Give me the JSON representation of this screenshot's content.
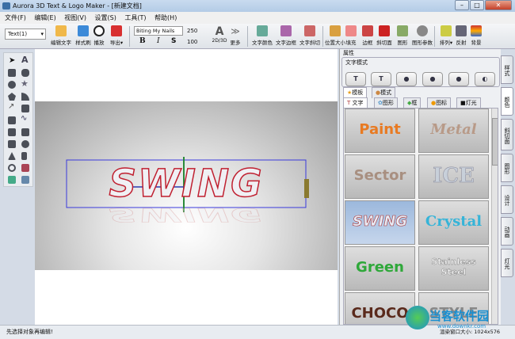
{
  "window": {
    "title": "Aurora 3D Text & Logo Maker - [新建文档]"
  },
  "menu": [
    "文件(F)",
    "编辑(E)",
    "视图(V)",
    "设置(S)",
    "工具(T)",
    "帮助(H)"
  ],
  "toolbar": {
    "object_select": "Text(1)",
    "edit_text": "编辑文字",
    "style_brush": "样式刷",
    "play": "播放",
    "export": "导出",
    "font": "Biting My Nails",
    "size1": "250",
    "size2": "100",
    "bold": "B",
    "italic": "I",
    "strike": "S",
    "mode_2d3d": "2D/3D",
    "more": "更多",
    "text_color": "文字颜色",
    "text_border": "文字边框",
    "text_bevel": "文字斜切",
    "position_size": "位置大小",
    "fill": "填充",
    "border": "边框",
    "bevel_face": "斜切面",
    "shape": "图形",
    "shape_params": "图形参数",
    "arrange": "排列",
    "reflect": "反射",
    "background": "背景"
  },
  "canvas": {
    "text": "SWING"
  },
  "panel": {
    "title": "属性",
    "text_style": "文字模式",
    "tabs": [
      "模板",
      "模式"
    ],
    "subtabs": [
      "文字",
      "图形",
      "框",
      "图标",
      "灯光"
    ],
    "templates": [
      {
        "label": "Paint",
        "color": "#e87a22"
      },
      {
        "label": "Metal",
        "color": "#b89a88"
      },
      {
        "label": "Sector",
        "color": "#a88f80"
      },
      {
        "label": "ICE",
        "color": "#c8d0da"
      },
      {
        "label": "SWING",
        "color": "#e8eef8"
      },
      {
        "label": "Crystal",
        "color": "#36b4d8"
      },
      {
        "label": "Green",
        "color": "#2fa83a"
      },
      {
        "label": "Stainless Steel",
        "color": "#e0e0e0"
      },
      {
        "label": "CHOCO",
        "color": "#5a2a1c"
      },
      {
        "label": "STYLE",
        "color": "#888"
      }
    ],
    "side_tabs": [
      "样式",
      "颜色",
      "斜切面",
      "图形",
      "设计",
      "动画",
      "灯光"
    ]
  },
  "status": {
    "message": "先选择对象再编辑!",
    "canvas_size": "渲染窗口大小: 1024x576"
  },
  "watermark": {
    "name": "当客软件园",
    "url": "www.downkr.com"
  }
}
